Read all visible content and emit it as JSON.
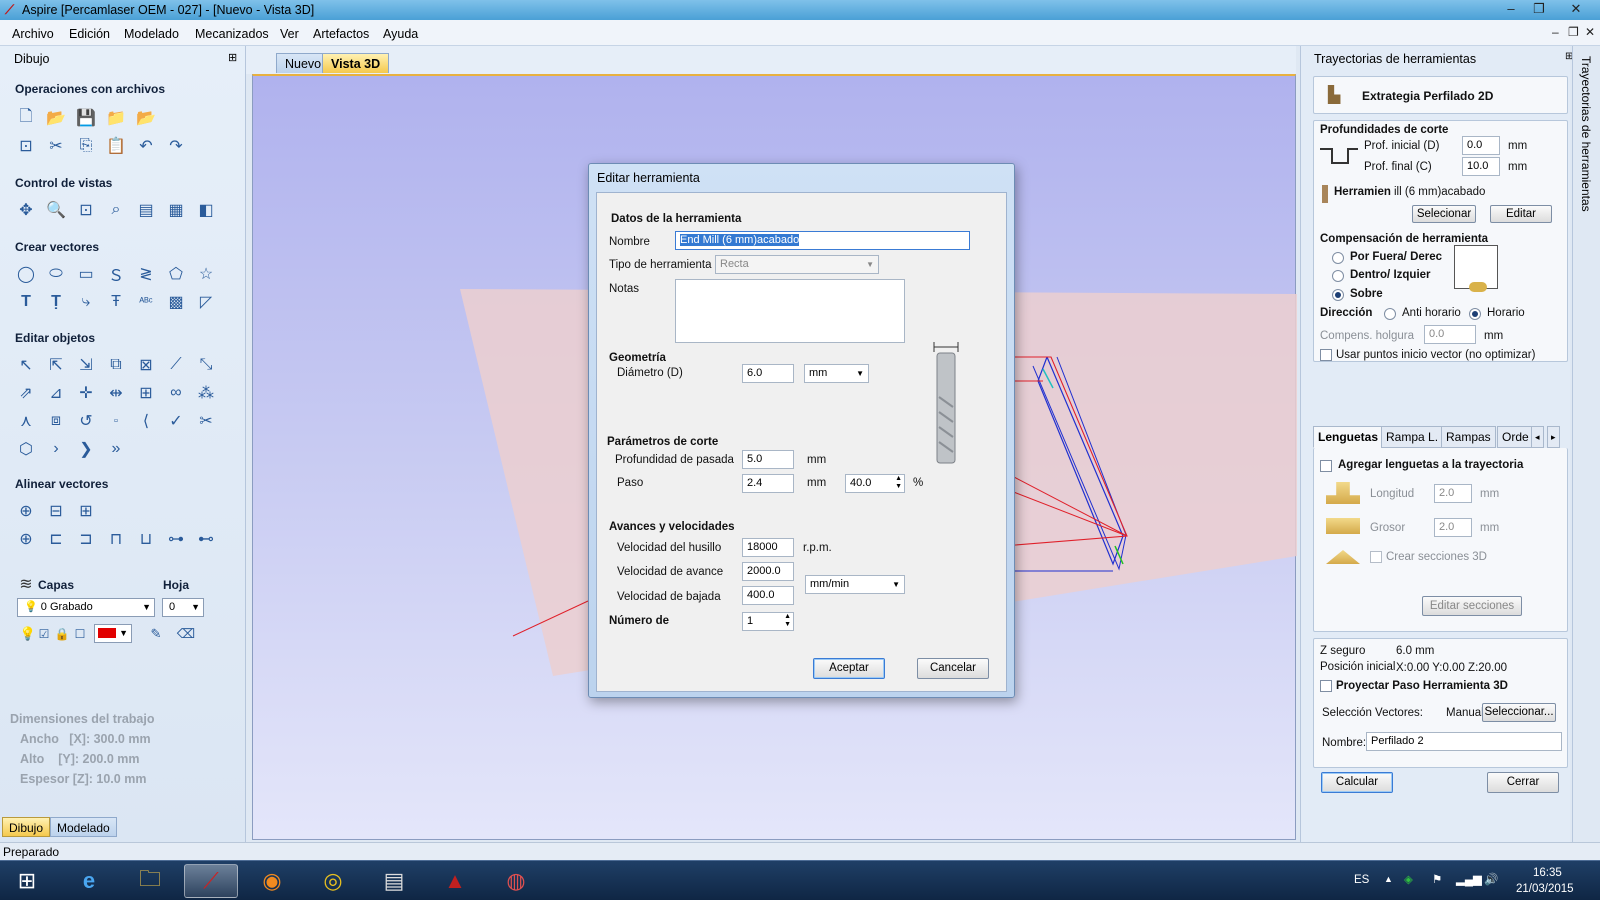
{
  "window": {
    "title": "Aspire [Percamlaser OEM - 027] - [Nuevo - Vista 3D]"
  },
  "menu": [
    "Archivo",
    "Edición",
    "Modelado",
    "Mecanizados",
    "Ver",
    "Artefactos",
    "Ayuda"
  ],
  "left_panel": {
    "title": "Dibujo",
    "sections": {
      "files": "Operaciones con archivos",
      "views": "Control de vistas",
      "vectors": "Crear vectores",
      "edit": "Editar objetos",
      "align": "Alinear vectores"
    },
    "layers_label": "Capas",
    "sheet_label": "Hoja",
    "layer_value": "0 Grabado",
    "sheet_value": "0",
    "job_dims": {
      "title": "Dimensiones del trabajo",
      "width": "Ancho   [X]: 300.0 mm",
      "height": "Alto    [Y]: 200.0 mm",
      "thickness": "Espesor [Z]: 10.0 mm"
    },
    "bottom_tabs": [
      "Dibujo",
      "Modelado"
    ]
  },
  "view_tabs": [
    "Nuevo",
    "Vista 3D"
  ],
  "dialog": {
    "title": "Editar herramienta",
    "tool_data": "Datos de la herramienta",
    "name_label": "Nombre",
    "name_value": "End Mill (6 mm)acabado",
    "tool_type_label": "Tipo de herramienta",
    "tool_type_value": "Recta",
    "notes_label": "Notas",
    "geometry": "Geometría",
    "diameter_label": "Diámetro (D)",
    "diameter_value": "6.0",
    "diameter_unit": "mm",
    "cut_params": "Parámetros de corte",
    "pass_depth_label": "Profundidad de pasada",
    "pass_depth_value": "5.0",
    "pass_depth_unit": "mm",
    "stepover_label": "Paso",
    "stepover_value": "2.4",
    "stepover_unit": "mm",
    "stepover_pct": "40.0",
    "pct_sign": "%",
    "feeds": "Avances y velocidades",
    "spindle_label": "Velocidad del husillo",
    "spindle_value": "18000",
    "spindle_unit": "r.p.m.",
    "feed_label": "Velocidad de avance",
    "feed_value": "2000.0",
    "feed_unit": "mm/min",
    "plunge_label": "Velocidad de bajada",
    "plunge_value": "400.0",
    "number_label": "Número de",
    "number_value": "1",
    "ok": "Aceptar",
    "cancel": "Cancelar"
  },
  "right_panel": {
    "title": "Trayectorias de herramientas",
    "strategy": "Extrategia Perfilado 2D",
    "cut_depths": "Profundidades de corte",
    "start_depth_label": "Prof. inicial (D)",
    "start_depth_value": "0.0",
    "end_depth_label": "Prof. final (C)",
    "end_depth_value": "10.0",
    "unit": "mm",
    "tool_label": "Herramien",
    "tool_value": "ill (6 mm)acabado",
    "select_btn": "Selecionar",
    "edit_btn": "Editar",
    "compensation": "Compensación de herramienta",
    "opt_outside": "Por Fuera/ Derec",
    "opt_inside": "Dentro/ Izquier",
    "opt_on": "Sobre",
    "direction_label": "Dirección",
    "ccw": "Anti horario",
    "cw": "Horario",
    "allowance_label": "Compens. holgura",
    "allowance_value": "0.0",
    "use_start_points": "Usar puntos inicio vector (no optimizar)",
    "tabs": [
      "Lenguetas",
      "Rampa L.",
      "Rampas",
      "Orde"
    ],
    "add_tabs": "Agregar lenguetas a la trayectoria",
    "length_label": "Longitud",
    "length_value": "2.0",
    "thickness_label": "Grosor",
    "thickness_value": "2.0",
    "create_3d": "Crear secciones 3D",
    "edit_sections": "Editar secciones",
    "safe_z_label": "Z seguro",
    "safe_z_value": "6.0 mm",
    "home_label": "Posición inicial",
    "home_value": "X:0.00 Y:0.00 Z:20.00",
    "project_3d": "Proyectar Paso Herramienta 3D",
    "vector_sel_label": "Selección Vectores:",
    "vector_sel_value": "Manual",
    "vector_sel_btn": "Seleccionar...",
    "name_label": "Nombre:",
    "name_value": "Perfilado 2",
    "calc_btn": "Calcular",
    "close_btn": "Cerrar"
  },
  "side_tab": "Trayectorias de herramientas",
  "status": "Preparado",
  "taskbar": {
    "lang": "ES",
    "time": "16:35",
    "date": "21/03/2015"
  }
}
